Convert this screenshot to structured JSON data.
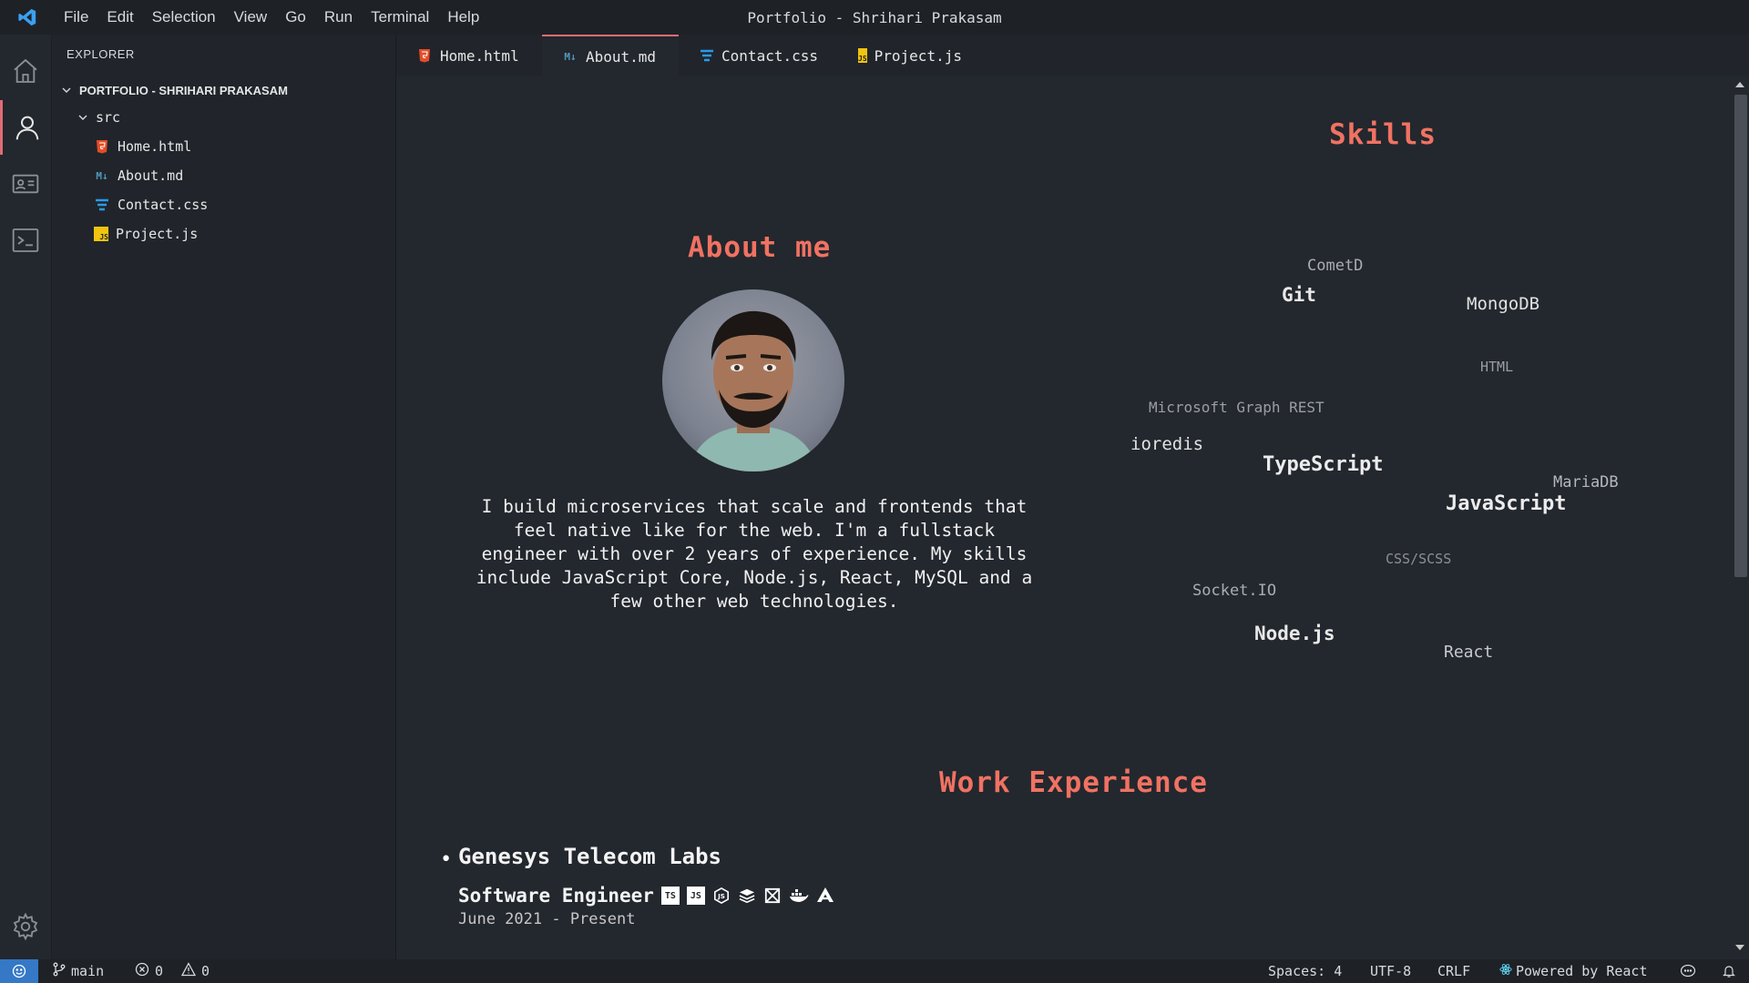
{
  "window": {
    "title": "Portfolio - Shrihari Prakasam"
  },
  "menu": [
    "File",
    "Edit",
    "Selection",
    "View",
    "Go",
    "Run",
    "Terminal",
    "Help"
  ],
  "activity_bar": {
    "items": [
      "home-icon",
      "person-icon",
      "contact-card-icon",
      "terminal-icon"
    ],
    "bottom": "gear-icon"
  },
  "explorer": {
    "title": "EXPLORER",
    "root": "PORTFOLIO - SHRIHARI PRAKASAM",
    "folder": "src",
    "files": [
      {
        "name": "Home.html",
        "icon": "html-file-icon",
        "color": "#e44d26"
      },
      {
        "name": "About.md",
        "icon": "markdown-file-icon",
        "color": "#519aba"
      },
      {
        "name": "Contact.css",
        "icon": "css-file-icon",
        "color": "#1572b6"
      },
      {
        "name": "Project.js",
        "icon": "js-file-icon",
        "color": "#f1c40f"
      }
    ]
  },
  "tabs": [
    {
      "label": "Home.html",
      "icon": "html-file-icon",
      "active": false
    },
    {
      "label": "About.md",
      "icon": "markdown-file-icon",
      "active": true
    },
    {
      "label": "Contact.css",
      "icon": "css-file-icon",
      "active": false
    },
    {
      "label": "Project.js",
      "icon": "js-file-icon",
      "active": false
    }
  ],
  "about": {
    "heading": "About me",
    "photo": "profile-photo",
    "text": "I build microservices that scale and frontends that feel native like for the web. I'm a fullstack engineer with over 2 years of experience. My skills include JavaScript Core, Node.js, React, MySQL and a few other web technologies."
  },
  "skills": {
    "heading": "Skills",
    "items": [
      "CometD",
      "Git",
      "MongoDB",
      "HTML",
      "Microsoft Graph REST",
      "ioredis",
      "TypeScript",
      "MariaDB",
      "JavaScript",
      "CSS/SCSS",
      "Socket.IO",
      "Node.js",
      "React"
    ]
  },
  "work": {
    "heading": "Work Experience",
    "jobs": [
      {
        "company": "Genesys Telecom Labs",
        "role": "Software Engineer",
        "dates": "June 2021 - Present",
        "tech_icons": [
          "typescript-icon",
          "javascript-icon",
          "nodejs-icon",
          "layers-icon",
          "ngrx-icon",
          "docker-icon",
          "angular-icon"
        ]
      }
    ]
  },
  "status": {
    "branch": "main",
    "errors": "0",
    "warnings": "0",
    "spaces": "Spaces: 4",
    "encoding": "UTF-8",
    "eol": "CRLF",
    "powered": "Powered by React"
  },
  "colors": {
    "accent": "#f07262",
    "tab_active_border": "#e06c75",
    "status_remote": "#3478c6"
  }
}
